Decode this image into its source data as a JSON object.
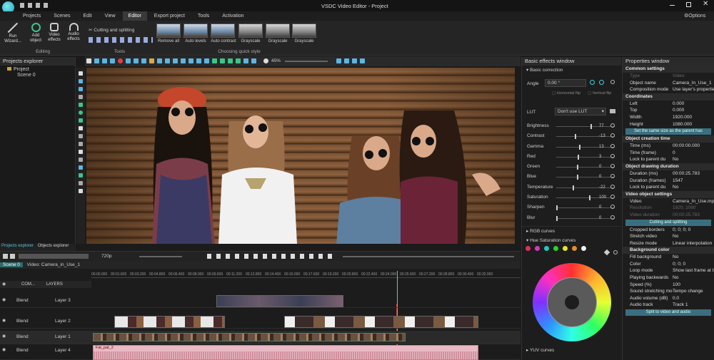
{
  "window": {
    "title": "VSDC Video Editor - Project",
    "options_label": "Options"
  },
  "menu": [
    "Projects",
    "Scenes",
    "Edit",
    "View",
    "Editor",
    "Export project",
    "Tools",
    "Activation"
  ],
  "ribbon": {
    "run_wizard": "Run Wizard...",
    "add_object": "Add object",
    "video_effects": "Video effects",
    "audio_effects": "Audio effects",
    "editing_label": "Editing",
    "cutting_label": "Cutting and splitting",
    "tools_label": "Tools",
    "quick_styles": [
      "Remove all",
      "Auto levels",
      "Auto contrast",
      "Grayscale",
      "Grayscale",
      "Grayscale"
    ],
    "quick_style_label": "Choosing quick style"
  },
  "projects_explorer": {
    "title": "Projects explorer",
    "project": "Project",
    "scene": "Scene 0",
    "tabs": [
      "Projects explorer",
      "Objects explorer"
    ]
  },
  "preview_toolbar": {
    "zoom": "45%",
    "quality": "720p"
  },
  "timeline": {
    "tabs": [
      "Scene 0",
      "Video: Camera_in_Use_1"
    ],
    "header_col": "COM...",
    "layers_label": "LAYERS",
    "ruler": [
      "00:00.000",
      "00:01.600",
      "00:03.200",
      "00:04.800",
      "00:06.400",
      "00:08.000",
      "00:09.600",
      "00:11.200",
      "00:12.800",
      "00:14.400",
      "00:16.000",
      "00:17.600",
      "00:19.200",
      "00:20.800",
      "00:22.400",
      "00:24.000",
      "00:25.600",
      "00:27.200",
      "00:28.800",
      "00:30.400",
      "00:32.000"
    ],
    "tracks": [
      {
        "blend": "Blend",
        "name": "Layer 3"
      },
      {
        "blend": "Blend",
        "name": "Layer 2"
      },
      {
        "blend": "Blend",
        "name": "Layer 1"
      },
      {
        "blend": "Blend",
        "name": "Layer 4"
      }
    ],
    "audio_clip_label": "Fat_pat_2"
  },
  "effects": {
    "title": "Basic effects window",
    "section": "Basic correction",
    "angle_label": "Angle",
    "angle_value": "0.00 °",
    "hflip": "Horizontal flip",
    "vflip": "Vertical flip",
    "lut_label": "LUT",
    "lut_value": "Don't use LUT",
    "sliders": [
      {
        "name": "Brightness",
        "value": "77",
        "pos": 0.83
      },
      {
        "name": "Contrast",
        "value": "-13",
        "pos": 0.44
      },
      {
        "name": "Gamma",
        "value": "13",
        "pos": 0.55
      },
      {
        "name": "Red",
        "value": "3",
        "pos": 0.52
      },
      {
        "name": "Green",
        "value": "0",
        "pos": 0.5
      },
      {
        "name": "Blue",
        "value": "0",
        "pos": 0.5
      },
      {
        "name": "Temperature",
        "value": "-22",
        "pos": 0.4
      },
      {
        "name": "Saturation",
        "value": "100",
        "pos": 0.8
      },
      {
        "name": "Sharpen",
        "value": "0",
        "pos": 0.0
      },
      {
        "name": "Blur",
        "value": "0",
        "pos": 0.0
      }
    ],
    "rgb_curves": "RGB curves",
    "hue_sat_curves": "Hue Saturation curves",
    "yuv_curves": "YUV curves",
    "swatches": [
      "#e0305a",
      "#d23bbd",
      "#27c4c4",
      "#2ad32a",
      "#e6e62a",
      "#e68a2a",
      "#f0f0f0"
    ]
  },
  "properties": {
    "title": "Properties window",
    "common_header": "Common settings",
    "type_label": "Type",
    "type_value": "Video",
    "object_name_label": "Object name",
    "object_name_value": "Camera_In_Use_1",
    "composition_label": "Composition mode",
    "composition_value": "Use layer's properties",
    "coordinates_header": "Coordinates",
    "coords": [
      {
        "k": "Left",
        "v": "0.000"
      },
      {
        "k": "Top",
        "v": "0.000"
      },
      {
        "k": "Width",
        "v": "1920.000"
      },
      {
        "k": "Height",
        "v": "1080.000"
      }
    ],
    "same_size_btn": "Set the same size as the parent has",
    "creation_header": "Object creation time",
    "creation": [
      {
        "k": "Time (ms)",
        "v": "00:00:00.000"
      },
      {
        "k": "Time (frame)",
        "v": "0"
      },
      {
        "k": "Lock to parent du",
        "v": "No"
      }
    ],
    "drawing_header": "Object drawing duration",
    "drawing": [
      {
        "k": "Duration (ms)",
        "v": "00:00:25.783"
      },
      {
        "k": "Duration (frames)",
        "v": "1547"
      },
      {
        "k": "Lock to parent du",
        "v": "No"
      }
    ],
    "video_header": "Video object settings",
    "video_k": "Video",
    "video_v": "Camera_In_Use.mp4",
    "resolution_k": "Resolution",
    "resolution_v": "1920; 1080",
    "video_duration_k": "Video duration",
    "video_duration_v": "00:00:25.783",
    "cutting_btn": "Cutting and splitting",
    "video_rows": [
      {
        "k": "Cropped borders",
        "v": "0; 0; 0; 0"
      },
      {
        "k": "Stretch video",
        "v": "No"
      },
      {
        "k": "Resize mode",
        "v": "Linear interpolation"
      }
    ],
    "bg_header": "Background color",
    "bg_rows": [
      {
        "k": "Fill background",
        "v": "No"
      },
      {
        "k": "Color",
        "v": "0; 0; 0"
      }
    ],
    "more_rows": [
      {
        "k": "Loop mode",
        "v": "Show last frame at the"
      },
      {
        "k": "Playing backwards",
        "v": "No"
      },
      {
        "k": "Speed (%)",
        "v": "100"
      },
      {
        "k": "Sound stretching mo",
        "v": "Tempo change"
      },
      {
        "k": "Audio volume (dB)",
        "v": "0.0"
      },
      {
        "k": "Audio track",
        "v": "Track 1"
      }
    ],
    "split_btn": "Split to video and audio"
  }
}
